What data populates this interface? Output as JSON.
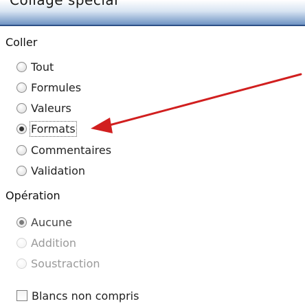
{
  "dialog": {
    "title": "Collage spécial"
  },
  "paste": {
    "label": "Coller",
    "options": [
      {
        "label": "Tout",
        "checked": false
      },
      {
        "label": "Formules",
        "checked": false
      },
      {
        "label": "Valeurs",
        "checked": false
      },
      {
        "label": "Formats",
        "checked": true
      },
      {
        "label": "Commentaires",
        "checked": false
      },
      {
        "label": "Validation",
        "checked": false
      }
    ]
  },
  "operation": {
    "label": "Opération",
    "options": [
      {
        "label": "Aucune",
        "checked": true
      },
      {
        "label": "Addition",
        "checked": false
      },
      {
        "label": "Soustraction",
        "checked": false
      }
    ]
  },
  "skip_blanks": {
    "label": "Blancs non compris",
    "checked": false
  },
  "annotation": {
    "arrow_color": "#d11f1f"
  }
}
